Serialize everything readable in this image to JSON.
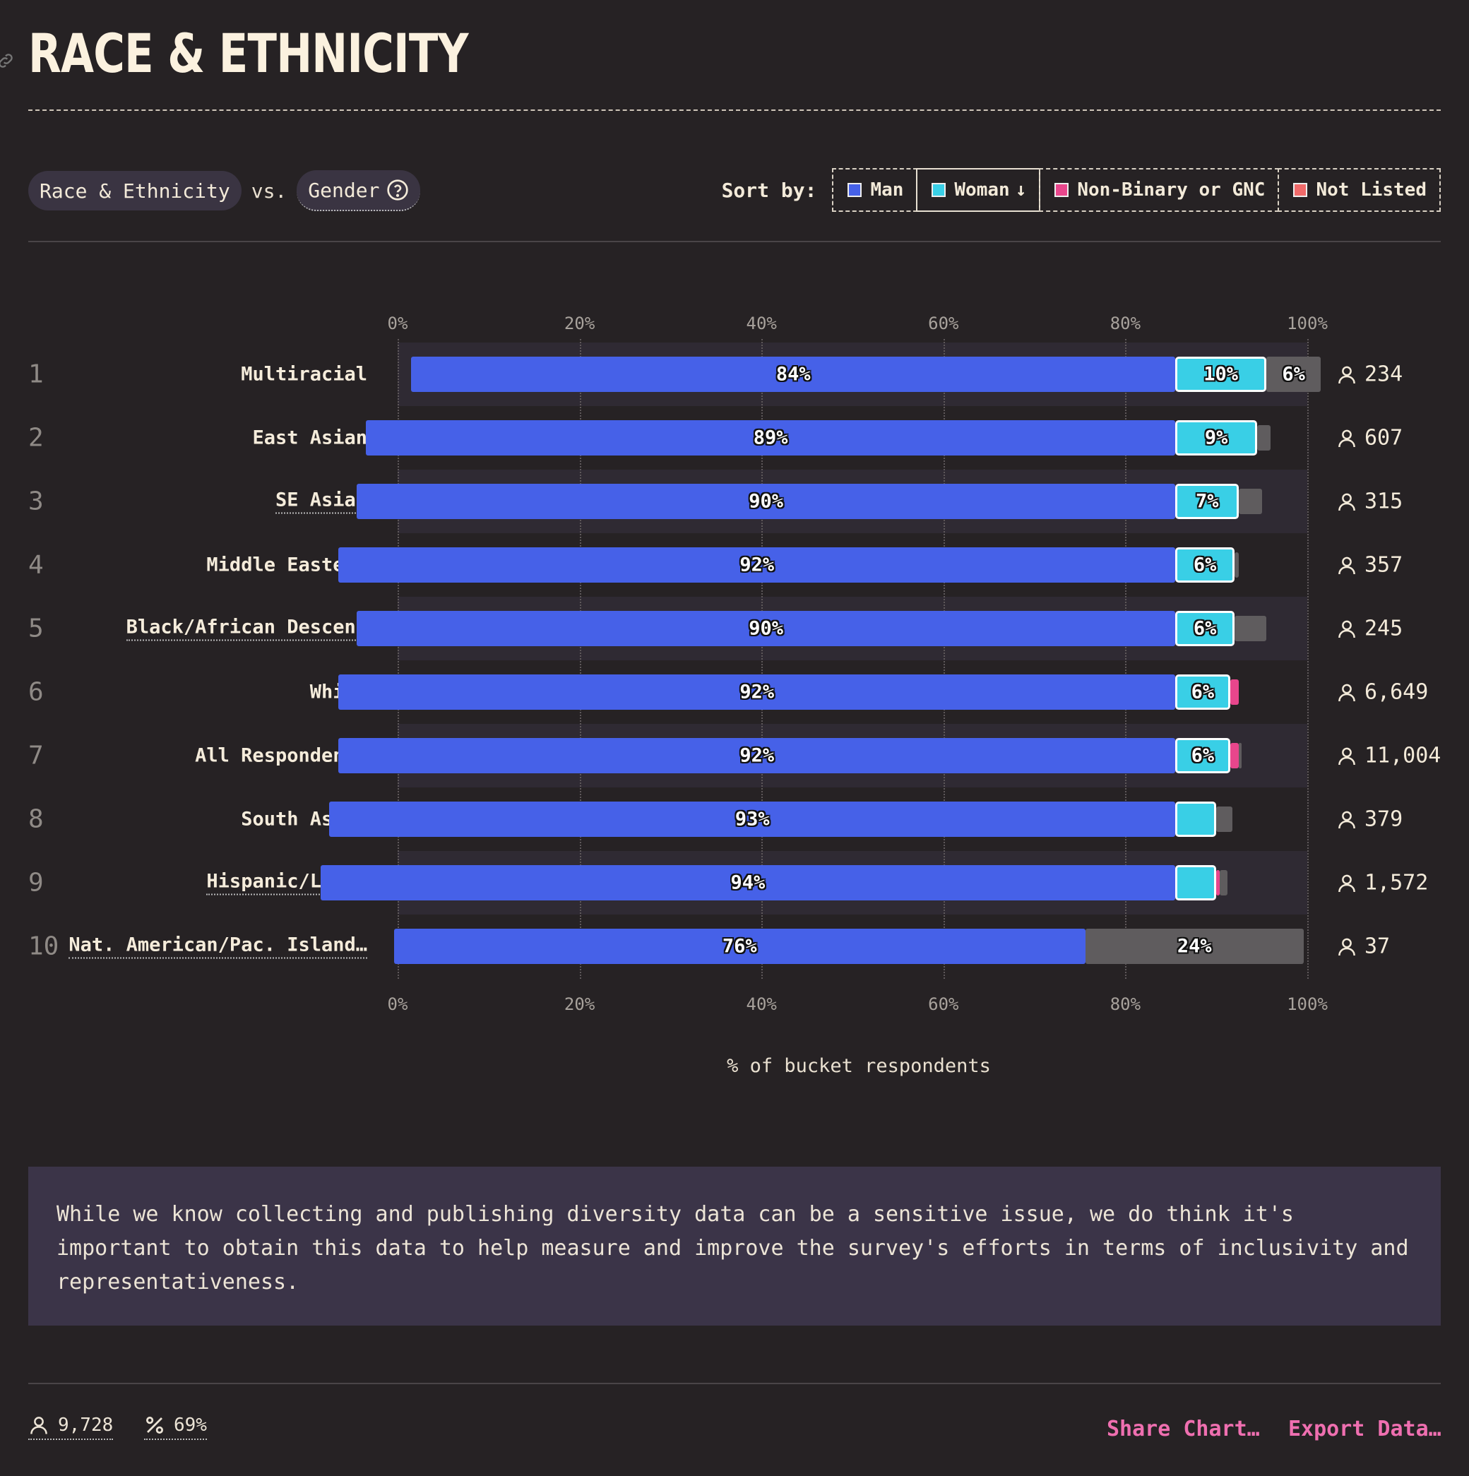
{
  "section": {
    "title": "RACE & ETHNICITY"
  },
  "controls": {
    "primary_pill": "Race & Ethnicity",
    "vs": "vs.",
    "secondary_pill": "Gender",
    "sort_label": "Sort by:",
    "sort_options": [
      {
        "label": "Man",
        "color": "#4661e8",
        "active": false
      },
      {
        "label": "Woman",
        "color": "#39cfe6",
        "active": true,
        "arrow": "↓"
      },
      {
        "label": "Non-Binary or GNC",
        "color": "#e8468c",
        "active": false
      },
      {
        "label": "Not Listed",
        "color": "#f06a6a",
        "active": false
      }
    ]
  },
  "chart_data": {
    "type": "bar",
    "orientation": "horizontal-stacked-100",
    "ticks": [
      "0%",
      "20%",
      "40%",
      "60%",
      "80%",
      "100%"
    ],
    "xlabel": "% of bucket respondents",
    "xlim": [
      0,
      100
    ],
    "grid": true,
    "series": [
      {
        "name": "Man",
        "color": "#4661e8"
      },
      {
        "name": "Woman",
        "color": "#39cfe6"
      },
      {
        "name": "Non-Binary or GNC",
        "color": "#e8468c"
      },
      {
        "name": "Not Listed",
        "color": "#5f5c5e"
      }
    ],
    "rows": [
      {
        "rank": "1",
        "label": "Multiracial",
        "count": "234",
        "underlined": false,
        "man": 84,
        "woman": 10,
        "nb": 0,
        "nl": 6,
        "man_label": "84%",
        "woman_label": "10%",
        "nl_label": "6%"
      },
      {
        "rank": "2",
        "label": "East Asian",
        "count": "607",
        "underlined": false,
        "man": 89,
        "woman": 9,
        "nb": 0,
        "nl": 1.5,
        "man_label": "89%",
        "woman_label": "9%",
        "nl_label": ""
      },
      {
        "rank": "3",
        "label": "SE Asian",
        "count": "315",
        "underlined": true,
        "man": 90,
        "woman": 7,
        "nb": 0,
        "nl": 2.5,
        "man_label": "90%",
        "woman_label": "7%",
        "nl_label": ""
      },
      {
        "rank": "4",
        "label": "Middle Eastern",
        "count": "357",
        "underlined": false,
        "man": 92,
        "woman": 6.5,
        "nb": 0,
        "nl": 0.5,
        "man_label": "92%",
        "woman_label": "6%",
        "nl_label": ""
      },
      {
        "rank": "5",
        "label": "Black/African Descent",
        "count": "245",
        "underlined": true,
        "man": 90,
        "woman": 6.5,
        "nb": 0,
        "nl": 3.5,
        "man_label": "90%",
        "woman_label": "6%",
        "nl_label": ""
      },
      {
        "rank": "6",
        "label": "White",
        "count": "6,649",
        "underlined": false,
        "man": 92,
        "woman": 6,
        "nb": 1,
        "nl": 0,
        "man_label": "92%",
        "woman_label": "6%",
        "nl_label": ""
      },
      {
        "rank": "7",
        "label": "All Respondents",
        "count": "11,004",
        "underlined": false,
        "man": 92,
        "woman": 6,
        "nb": 1,
        "nl": 0.3,
        "man_label": "92%",
        "woman_label": "6%",
        "nl_label": ""
      },
      {
        "rank": "8",
        "label": "South Asian",
        "count": "379",
        "underlined": false,
        "man": 93,
        "woman": 4.5,
        "nb": 0,
        "nl": 1.8,
        "man_label": "93%",
        "woman_label": "",
        "nl_label": ""
      },
      {
        "rank": "9",
        "label": "Hispanic/Latin",
        "count": "1,572",
        "underlined": true,
        "man": 94,
        "woman": 4.5,
        "nb": 0.4,
        "nl": 0.8,
        "man_label": "94%",
        "woman_label": "",
        "nl_label": ""
      },
      {
        "rank": "10",
        "label": "Nat. American/Pac. Island…",
        "count": "37",
        "underlined": true,
        "man": 76,
        "woman": 0,
        "nb": 0,
        "nl": 24,
        "man_label": "76%",
        "woman_label": "",
        "nl_label": "24%"
      }
    ]
  },
  "note": {
    "text": "While we know collecting and publishing diversity data can be a sensitive issue, we do think it's important to obtain this data to help measure and improve the survey's efforts in terms of inclusivity and representativeness."
  },
  "footer": {
    "respondents": "9,728",
    "percentage": "69%",
    "share_label": "Share Chart…",
    "export_label": "Export Data…"
  }
}
